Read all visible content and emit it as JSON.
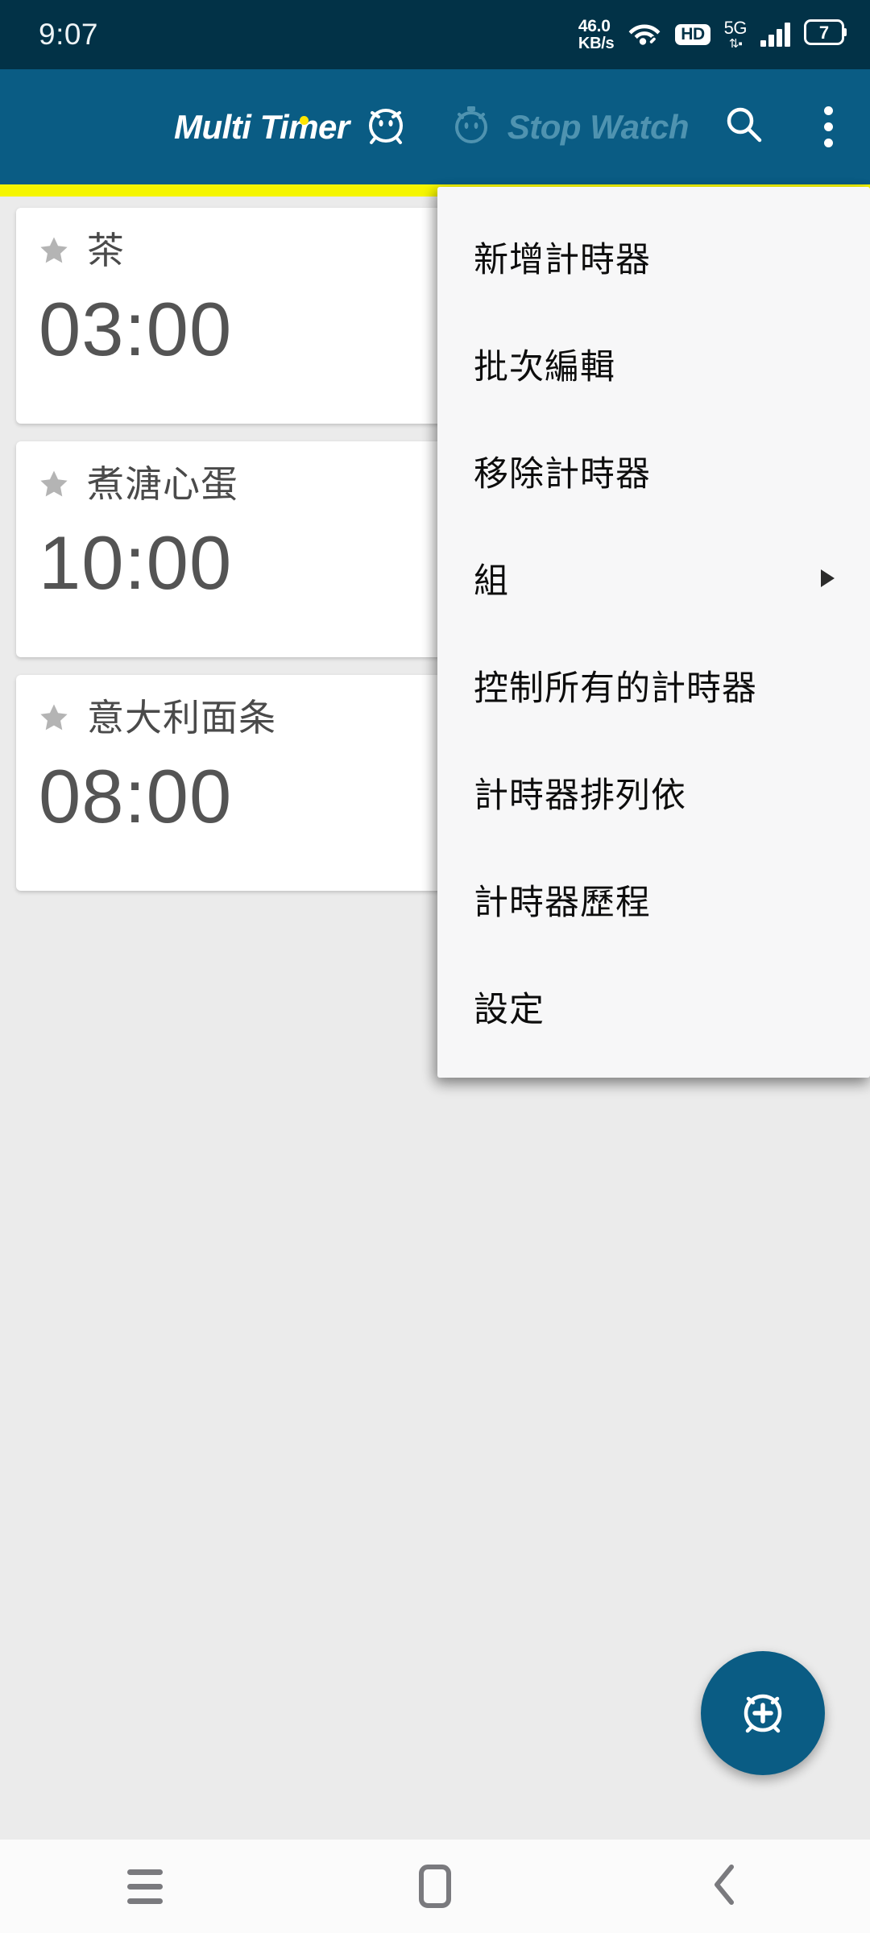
{
  "status_bar": {
    "clock": "9:07",
    "net_speed_value": "46.0",
    "net_speed_unit": "KB/s",
    "wifi_icon": "wifi-icon",
    "hd_badge": "HD",
    "network_type": "5G",
    "signal_icon": "signal-bars-icon",
    "battery_level": "7",
    "background_color": "#023247"
  },
  "app_bar": {
    "background_color": "#0a5c84",
    "tabs": [
      {
        "label": "Multi Timer",
        "icon": "alarm-clock-face-icon",
        "selected": true
      },
      {
        "label": "Stop Watch",
        "icon": "stopwatch-icon",
        "selected": false
      }
    ],
    "search_icon": "search-icon",
    "overflow_icon": "kebab-menu-icon",
    "indicator_color": "#f5f500"
  },
  "timers": [
    {
      "favorite_icon": "star-icon",
      "name": "茶",
      "time": "03:00"
    },
    {
      "favorite_icon": "star-icon",
      "name": "煮溏心蛋",
      "time": "10:00"
    },
    {
      "favorite_icon": "star-icon",
      "name": "意大利面条",
      "time": "08:00"
    }
  ],
  "fab": {
    "icon": "add-alarm-icon",
    "color": "#0a5c84"
  },
  "overflow_menu": {
    "items": [
      {
        "label": "新增計時器",
        "has_submenu": false
      },
      {
        "label": "批次編輯",
        "has_submenu": false
      },
      {
        "label": "移除計時器",
        "has_submenu": false
      },
      {
        "label": "組",
        "has_submenu": true
      },
      {
        "label": "控制所有的計時器",
        "has_submenu": false
      },
      {
        "label": "計時器排列依",
        "has_submenu": false
      },
      {
        "label": "計時器歷程",
        "has_submenu": false
      },
      {
        "label": "設定",
        "has_submenu": false
      }
    ]
  },
  "nav_bar": {
    "recents_icon": "recents-icon",
    "home_icon": "home-icon",
    "back_icon": "back-chevron-icon"
  }
}
